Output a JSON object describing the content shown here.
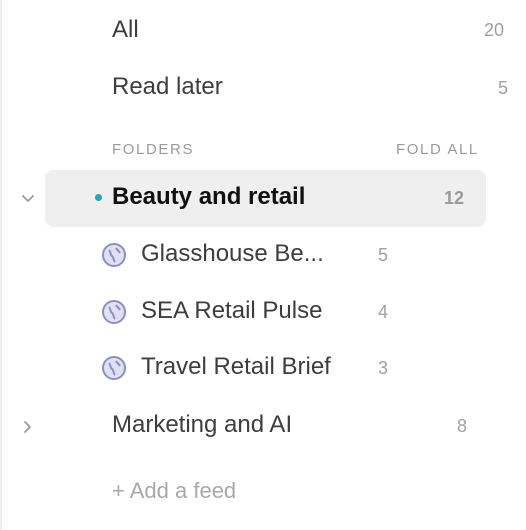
{
  "nav": {
    "all": {
      "label": "All",
      "count": "20"
    },
    "read_later": {
      "label": "Read later",
      "count": "5"
    }
  },
  "folders_header": {
    "title": "FOLDERS",
    "fold_all": "FOLD ALL"
  },
  "folders": [
    {
      "label": "Beauty and retail",
      "count": "12",
      "expanded": true,
      "active": true,
      "unread_dot_color": "#1ea7b5",
      "feeds": [
        {
          "label": "Glasshouse Be...",
          "count": "5",
          "icon": "globe-icon"
        },
        {
          "label": "SEA Retail Pulse",
          "count": "4",
          "icon": "globe-icon"
        },
        {
          "label": "Travel Retail Brief",
          "count": "3",
          "icon": "globe-icon"
        }
      ]
    },
    {
      "label": "Marketing and AI",
      "count": "8",
      "expanded": false
    }
  ],
  "add_feed": {
    "label": "+ Add a feed"
  },
  "colors": {
    "accent": "#1ea7b5",
    "active_bg": "#efefef",
    "icon": "#8a8fc4"
  }
}
